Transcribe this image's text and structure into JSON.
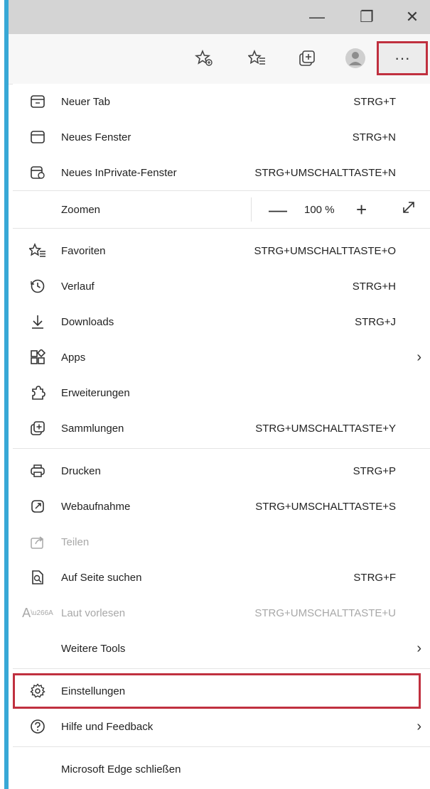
{
  "window": {
    "minimize_glyph": "—",
    "restore_glyph": "❐",
    "close_glyph": "✕"
  },
  "toolbar": {
    "icons": [
      "add-favorite-icon",
      "favorites-icon",
      "collections-icon",
      "profile-icon"
    ],
    "more_label": "···"
  },
  "menu": {
    "items": [
      {
        "id": "new-tab",
        "label": "Neuer Tab",
        "shortcut": "STRG+T",
        "icon": "new-tab-icon"
      },
      {
        "id": "new-window",
        "label": "Neues Fenster",
        "shortcut": "STRG+N",
        "icon": "new-window-icon"
      },
      {
        "id": "new-inprivate",
        "label": "Neues InPrivate-Fenster",
        "shortcut": "STRG+UMSCHALTTASTE+N",
        "icon": "inprivate-icon"
      },
      {
        "id": "zoom",
        "label": "Zoomen",
        "value": "100 %"
      },
      {
        "id": "favorites",
        "label": "Favoriten",
        "shortcut": "STRG+UMSCHALTTASTE+O",
        "icon": "favorites-icon"
      },
      {
        "id": "history",
        "label": "Verlauf",
        "shortcut": "STRG+H",
        "icon": "history-icon"
      },
      {
        "id": "downloads",
        "label": "Downloads",
        "shortcut": "STRG+J",
        "icon": "download-icon"
      },
      {
        "id": "apps",
        "label": "Apps",
        "icon": "apps-icon",
        "submenu": true
      },
      {
        "id": "extensions",
        "label": "Erweiterungen",
        "icon": "extensions-icon"
      },
      {
        "id": "collections",
        "label": "Sammlungen",
        "shortcut": "STRG+UMSCHALTTASTE+Y",
        "icon": "collections-icon"
      },
      {
        "id": "print",
        "label": "Drucken",
        "shortcut": "STRG+P",
        "icon": "print-icon"
      },
      {
        "id": "web-capture",
        "label": "Webaufnahme",
        "shortcut": "STRG+UMSCHALTTASTE+S",
        "icon": "web-capture-icon"
      },
      {
        "id": "share",
        "label": "Teilen",
        "icon": "share-icon",
        "disabled": true
      },
      {
        "id": "find",
        "label": "Auf Seite suchen",
        "shortcut": "STRG+F",
        "icon": "find-icon"
      },
      {
        "id": "read-aloud",
        "label": "Laut vorlesen",
        "shortcut": "STRG+UMSCHALTTASTE+U",
        "icon": "read-aloud-icon",
        "disabled": true
      },
      {
        "id": "more-tools",
        "label": "Weitere Tools",
        "submenu": true
      },
      {
        "id": "settings",
        "label": "Einstellungen",
        "icon": "settings-gear-icon",
        "highlighted": true
      },
      {
        "id": "help",
        "label": "Hilfe und Feedback",
        "icon": "help-icon",
        "submenu": true
      },
      {
        "id": "close-edge",
        "label": "Microsoft Edge schließen"
      }
    ]
  },
  "colors": {
    "highlight_border": "#c0303f",
    "window_accent": "#38a8d6"
  }
}
